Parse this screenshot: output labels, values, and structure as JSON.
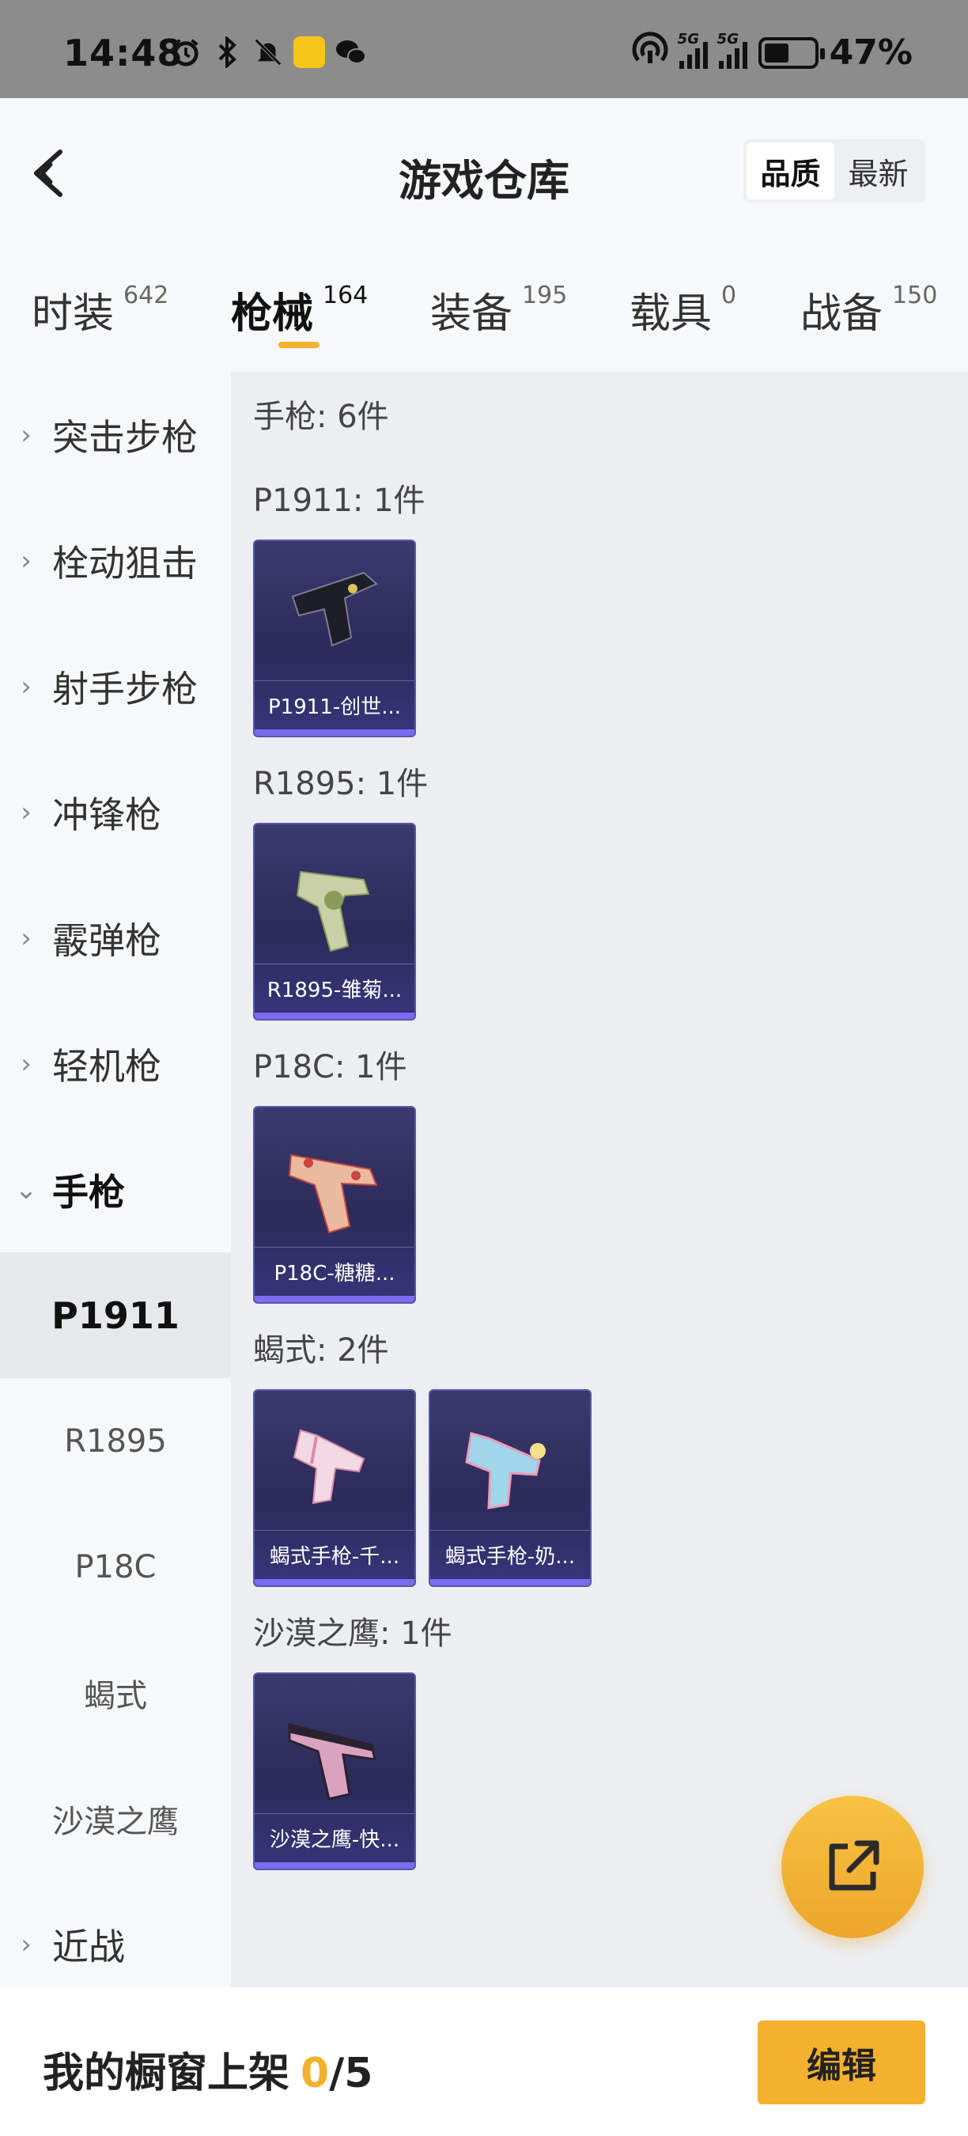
{
  "status_bar": {
    "time": "14:48",
    "network_1": "5G",
    "network_2": "5G",
    "battery": "47%",
    "icons": [
      "alarm-icon",
      "bluetooth-icon",
      "mute-icon",
      "app-icon",
      "wechat-icon",
      "hotspot-icon"
    ]
  },
  "header": {
    "title": "游戏仓库",
    "sort_options": [
      {
        "label": "品质",
        "active": true
      },
      {
        "label": "最新",
        "active": false
      }
    ]
  },
  "tabs": [
    {
      "label": "时装",
      "count": "642",
      "active": false
    },
    {
      "label": "枪械",
      "count": "164",
      "active": true
    },
    {
      "label": "装备",
      "count": "195",
      "active": false
    },
    {
      "label": "载具",
      "count": "0",
      "active": false
    },
    {
      "label": "战备",
      "count": "150",
      "active": false
    }
  ],
  "sidebar": {
    "categories": [
      {
        "label": "突击步枪",
        "expanded": false
      },
      {
        "label": "栓动狙击",
        "expanded": false
      },
      {
        "label": "射手步枪",
        "expanded": false
      },
      {
        "label": "冲锋枪",
        "expanded": false
      },
      {
        "label": "霰弹枪",
        "expanded": false
      },
      {
        "label": "轻机枪",
        "expanded": false
      },
      {
        "label": "手枪",
        "expanded": true
      }
    ],
    "subitems": [
      {
        "label": "P1911",
        "active": true
      },
      {
        "label": "R1895",
        "active": false
      },
      {
        "label": "P18C",
        "active": false
      },
      {
        "label": "蝎式",
        "active": false
      },
      {
        "label": "沙漠之鹰",
        "active": false
      }
    ],
    "last_category": {
      "label": "近战",
      "expanded": false
    }
  },
  "main": {
    "summary": "手枪: 6件",
    "groups": [
      {
        "label": "P1911: 1件",
        "items": [
          {
            "name": "P1911-创世...",
            "gun_color": "#1e1e26",
            "accent": "#d8c55a"
          }
        ]
      },
      {
        "label": "R1895: 1件",
        "items": [
          {
            "name": "R1895-雏菊...",
            "gun_color": "#c9cfa6",
            "accent": "#8a9a5a"
          }
        ]
      },
      {
        "label": "P18C: 1件",
        "items": [
          {
            "name": "P18C-糖糖...",
            "gun_color": "#e9b9a0",
            "accent": "#c8463e"
          }
        ]
      },
      {
        "label": "蝎式: 2件",
        "items": [
          {
            "name": "蝎式手枪-千...",
            "gun_color": "#f3d9e4",
            "accent": "#d98aa6"
          },
          {
            "name": "蝎式手枪-奶...",
            "gun_color": "#9fd6ea",
            "accent": "#f09ab8"
          }
        ]
      },
      {
        "label": "沙漠之鹰: 1件",
        "items": [
          {
            "name": "沙漠之鹰-快...",
            "gun_color": "#d9a3c0",
            "accent": "#2a2230"
          }
        ]
      }
    ]
  },
  "fab": {
    "icon": "share-external-icon"
  },
  "bottom_bar": {
    "label": "我的橱窗上架",
    "current": "0",
    "total": "/5",
    "edit_label": "编辑"
  },
  "colors": {
    "accent": "#f3b12d",
    "card_bg": "#2c2b5a",
    "card_bar": "#7b6cf0",
    "panel_bg": "#eceef1",
    "sidebar_bg": "#f7f8fa"
  }
}
